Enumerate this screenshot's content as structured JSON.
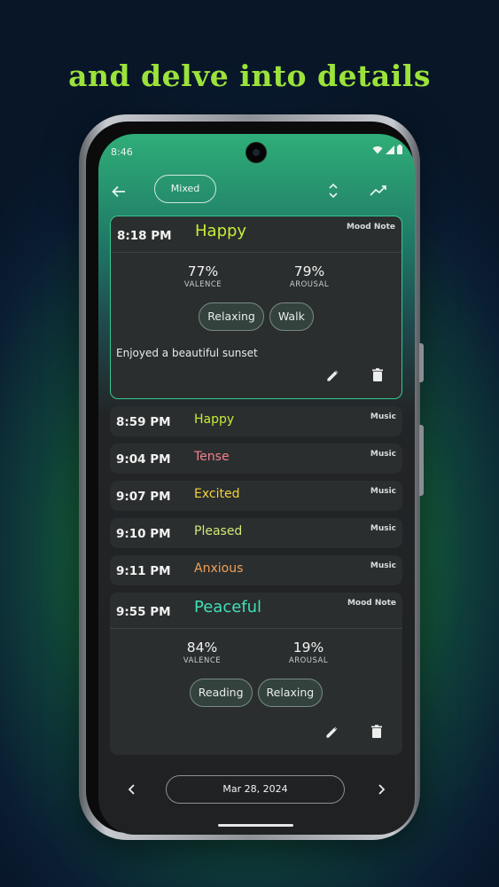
{
  "promo": {
    "title": "and delve into details"
  },
  "status_bar": {
    "time": "8:46",
    "icons": [
      "wifi-icon",
      "signal-icon",
      "battery-icon"
    ]
  },
  "toolbar": {
    "filter_chip": "Mixed",
    "icons": [
      "back-arrow-icon",
      "sort-icon",
      "trend-icon"
    ]
  },
  "entries": [
    {
      "time": "8:18 PM",
      "mood": "Happy",
      "mood_color": "#c4ee3a",
      "type": "Mood Note",
      "valence": "77%",
      "valence_label": "VALENCE",
      "arousal": "79%",
      "arousal_label": "AROUSAL",
      "tags": [
        "Relaxing",
        "Walk"
      ],
      "note": "Enjoyed a beautiful sunset"
    },
    {
      "time": "8:59 PM",
      "mood": "Happy",
      "mood_color": "#c4ee3a",
      "type": "Music"
    },
    {
      "time": "9:04 PM",
      "mood": "Tense",
      "mood_color": "#f08090",
      "type": "Music"
    },
    {
      "time": "9:07 PM",
      "mood": "Excited",
      "mood_color": "#f2d23c",
      "type": "Music"
    },
    {
      "time": "9:10 PM",
      "mood": "Pleased",
      "mood_color": "#d2e878",
      "type": "Music"
    },
    {
      "time": "9:11 PM",
      "mood": "Anxious",
      "mood_color": "#f0a05a",
      "type": "Music"
    },
    {
      "time": "9:55 PM",
      "mood": "Peaceful",
      "mood_color": "#3fe0b8",
      "type": "Mood Note",
      "valence": "84%",
      "valence_label": "VALENCE",
      "arousal": "19%",
      "arousal_label": "AROUSAL",
      "tags": [
        "Reading",
        "Relaxing"
      ]
    }
  ],
  "bottom_nav": {
    "date": "Mar 28, 2024",
    "icons": [
      "chevron-left-icon",
      "chevron-right-icon"
    ]
  },
  "colors": {
    "accent_green": "#9be33a",
    "selected_border": "#35c98f"
  }
}
